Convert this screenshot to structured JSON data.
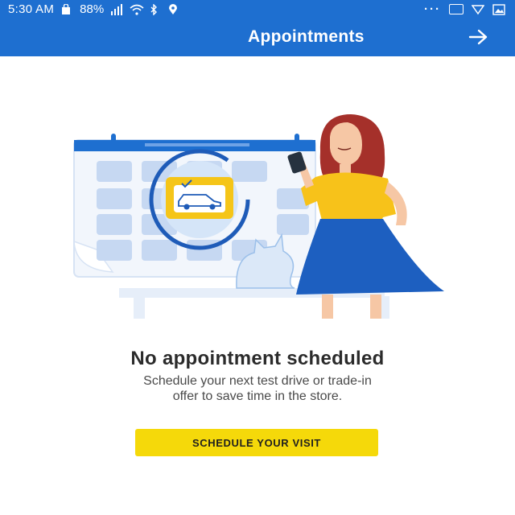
{
  "status_bar": {
    "time": "5:30 AM",
    "battery": "88%",
    "icons": [
      "location-icon",
      "bluetooth-icon",
      "wifi-icon",
      "signal-icon",
      "battery-icon",
      "alarm-icon",
      "image-icon",
      "bag-icon",
      "more-dots-icon"
    ]
  },
  "app_bar": {
    "title": "Appointments",
    "nav_icon": "arrow-icon"
  },
  "empty_state": {
    "heading": "No appointment scheduled",
    "subtext_line1": "Schedule your next test drive or trade-in",
    "subtext_line2": "offer to save time in the store.",
    "button_label": "SCHEDULE YOUR VISIT"
  },
  "colors": {
    "primary": "#1e6fd0",
    "accent": "#f5d90a",
    "text": "#2b2b2b"
  }
}
